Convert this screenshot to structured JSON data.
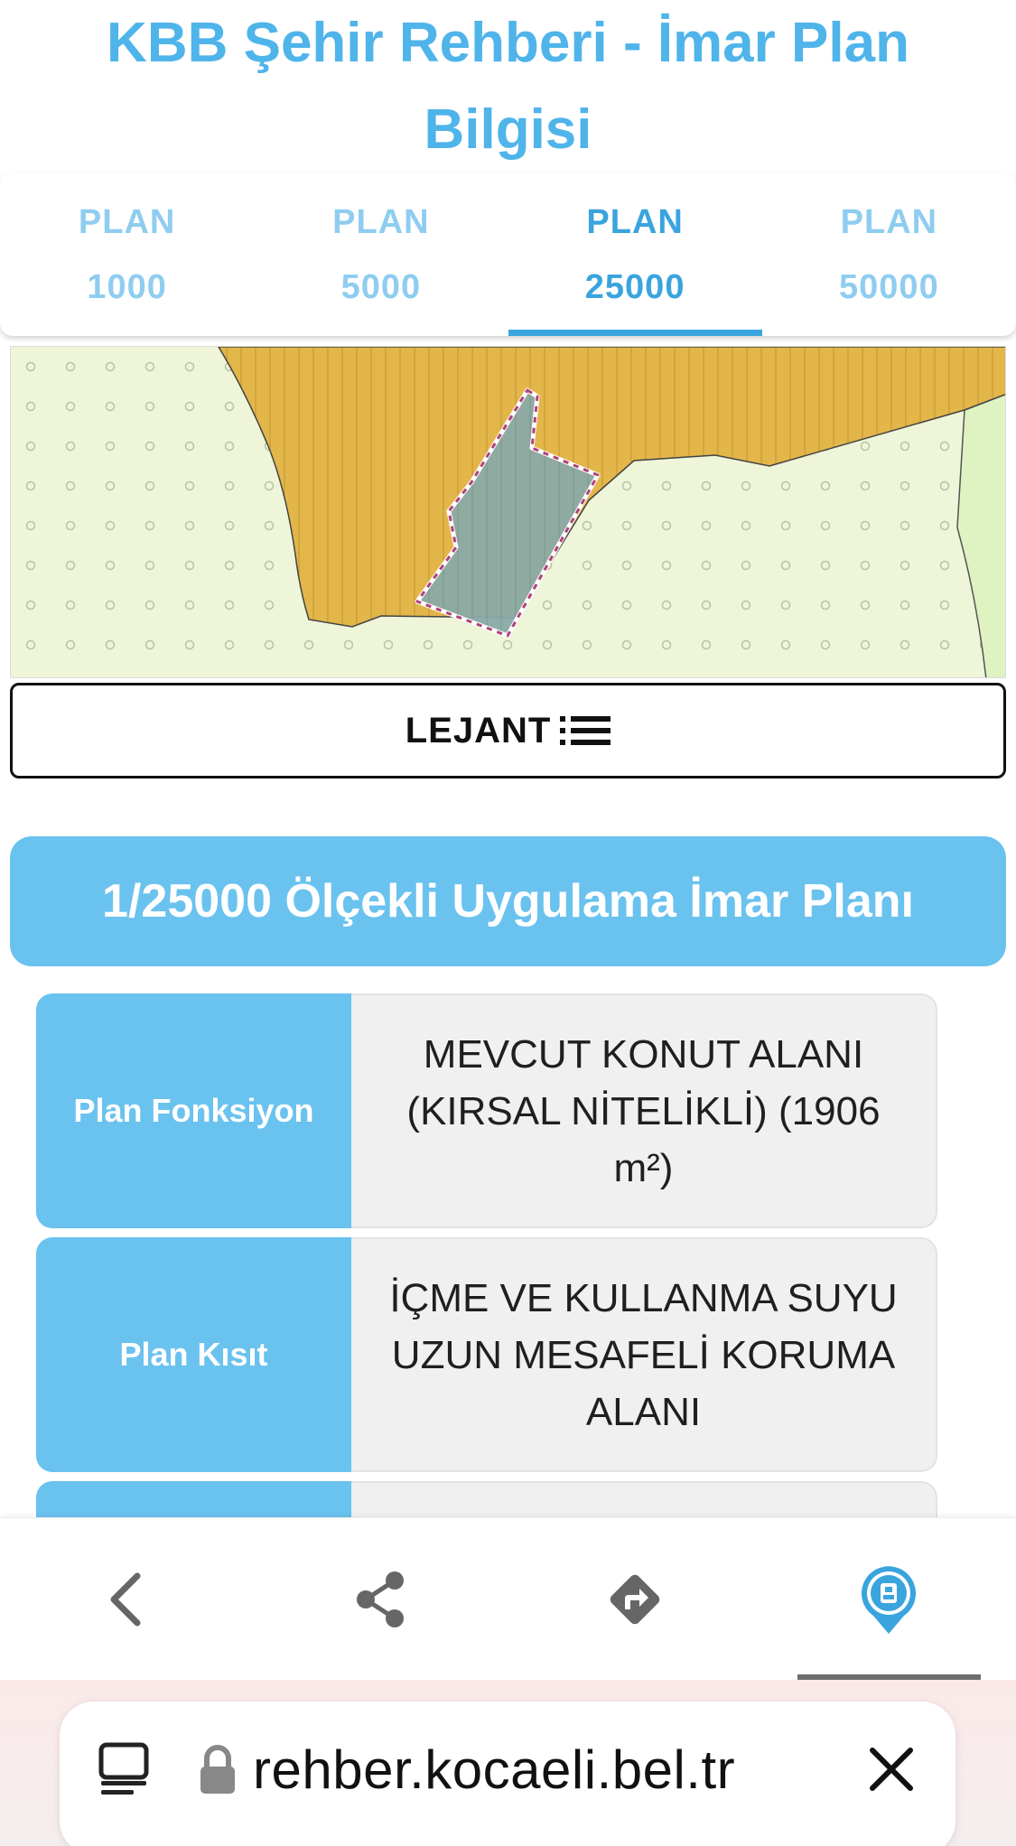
{
  "header": {
    "title_line1": "KBB Şehir Rehberi - İmar Plan",
    "title_line2": "Bilgisi"
  },
  "tabs": [
    {
      "line1": "PLAN",
      "line2": "1000",
      "active": false
    },
    {
      "line1": "PLAN",
      "line2": "5000",
      "active": false
    },
    {
      "line1": "PLAN",
      "line2": "25000",
      "active": true
    },
    {
      "line1": "PLAN",
      "line2": "50000",
      "active": false
    }
  ],
  "legend_button": {
    "label": "LEJANT",
    "icon": "list-icon"
  },
  "section": {
    "title": "1/25000 Ölçekli Uygulama İmar Planı"
  },
  "info_rows": [
    {
      "label": "Plan Fonksiyon",
      "value_lines": [
        "MEVCUT KONUT ALANI",
        "(KIRSAL NİTELİKLİ) (1906",
        "m²)"
      ]
    },
    {
      "label": "Plan Kısıt",
      "value_lines": [
        "İÇME VE KULLANMA SUYU",
        "UZUN MESAFELİ KORUMA",
        "ALANI"
      ]
    },
    {
      "label": "",
      "value_lines": []
    }
  ],
  "bottom_nav": [
    {
      "icon": "back-chevron-icon",
      "active": false
    },
    {
      "icon": "share-icon",
      "active": false
    },
    {
      "icon": "directions-icon",
      "active": false
    },
    {
      "icon": "kocaeli-logo-icon",
      "active": true
    }
  ],
  "browser": {
    "url": "rehber.kocaeli.bel.tr",
    "icons": [
      "page-menu-icon",
      "lock-icon",
      "close-icon"
    ]
  },
  "colors": {
    "accent": "#4fb4ea",
    "tab_active": "#3aa4de",
    "tab_inactive": "#8fcdf0",
    "header_bg": "#6ac2ef",
    "residential_zone": "#e3b64a",
    "rural_area": "#eef5d8",
    "parcel": "#8aa9a6"
  }
}
